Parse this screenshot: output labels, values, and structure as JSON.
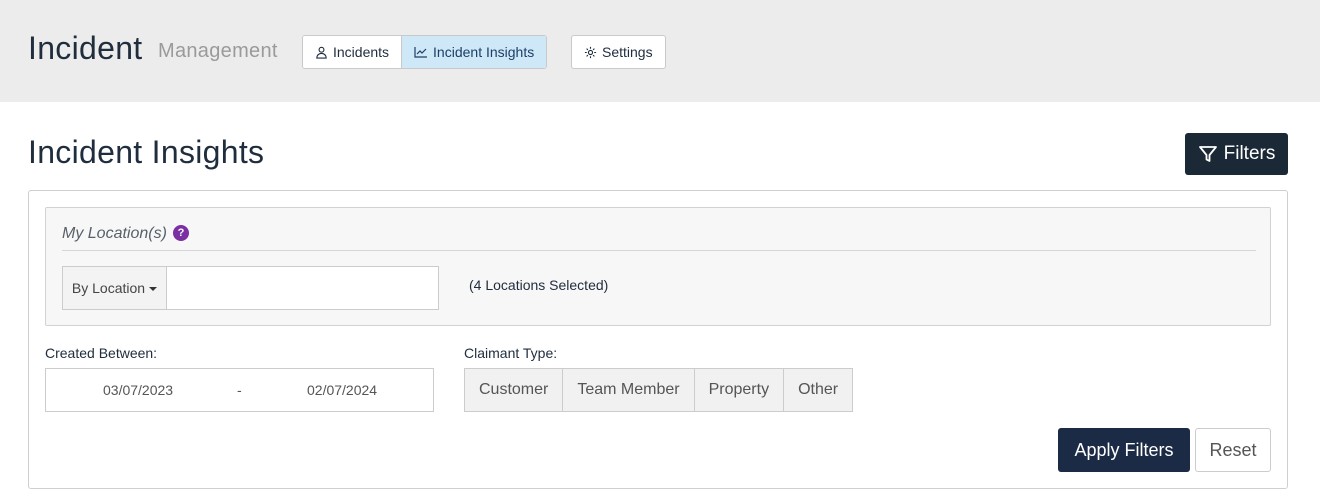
{
  "header": {
    "brand_main": "Incident",
    "brand_sub": "Management",
    "nav": {
      "incidents": "Incidents",
      "insights": "Incident Insights"
    },
    "settings": "Settings"
  },
  "page": {
    "title": "Incident Insights",
    "filters_button": "Filters"
  },
  "location": {
    "label": "My Location(s)",
    "help": "?",
    "dropdown": "By Location",
    "input_value": "",
    "selected_summary": "(4 Locations Selected)"
  },
  "created_between": {
    "label": "Created Between:",
    "from": "03/07/2023",
    "separator": "-",
    "to": "02/07/2024"
  },
  "claimant": {
    "label": "Claimant Type:",
    "options": [
      "Customer",
      "Team Member",
      "Property",
      "Other"
    ]
  },
  "actions": {
    "apply": "Apply Filters",
    "reset": "Reset"
  },
  "colors": {
    "header_bg": "#ececec",
    "active_tab_bg": "#cfe8f8",
    "dark_button": "#1b2836",
    "apply_button": "#1b2b45",
    "help_icon": "#7a2fa3"
  }
}
